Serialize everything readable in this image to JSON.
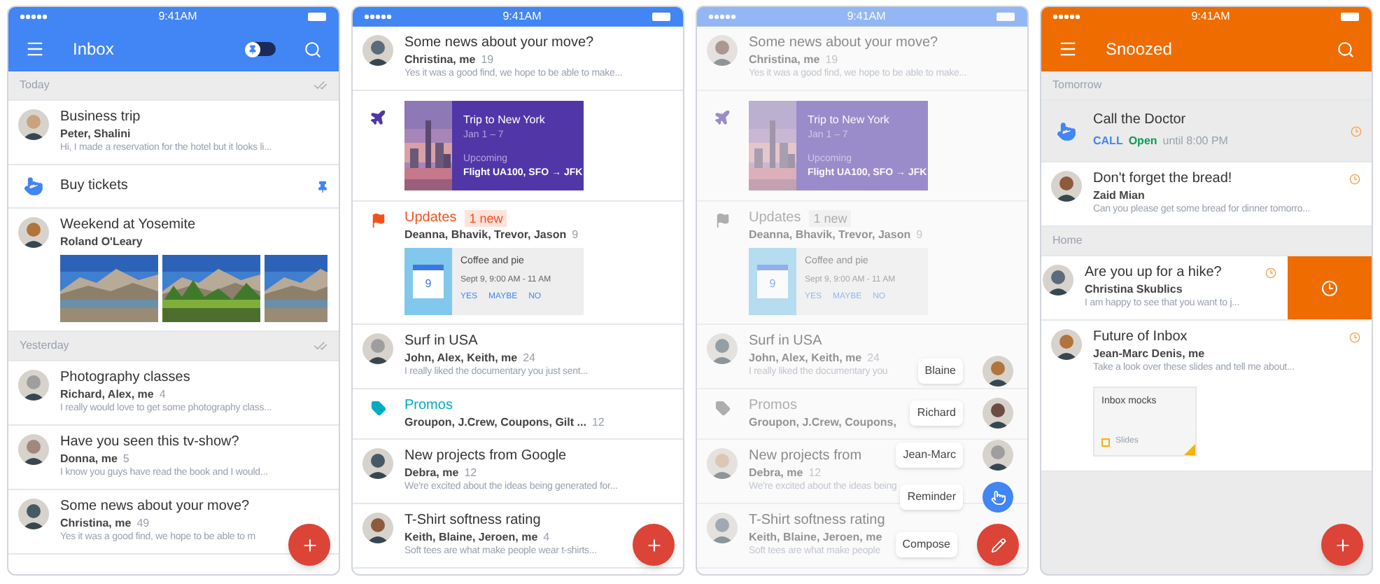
{
  "phones": [
    {
      "color": "#4285f4",
      "status_time": "9:41AM",
      "app_bar": {
        "title": "Inbox",
        "toggle": {
          "on": false
        }
      },
      "items": [
        {
          "kind": "header",
          "label": "Today",
          "done_all": true
        },
        {
          "kind": "message",
          "title": "Business trip",
          "senders": "Peter, Shalini",
          "snippet": "Hi, I made a reservation for the hotel but it looks li..."
        },
        {
          "kind": "reminder",
          "title": "Buy tickets",
          "pinned": true,
          "snoozed": false
        },
        {
          "kind": "message",
          "title": "Weekend at Yosemite",
          "senders": "Roland O'Leary"
        },
        {
          "kind": "header",
          "label": "Yesterday",
          "done_all": true
        },
        {
          "kind": "message",
          "title": "Photography classes",
          "senders": "Richard, Alex, me",
          "count": "4",
          "snippet": "I really would love to get some photography class..."
        },
        {
          "kind": "message",
          "title": "Have you seen this tv-show?",
          "senders": "Donna, me",
          "count": "5",
          "snippet": "I know you guys have read the book and I would..."
        },
        {
          "kind": "message",
          "title": "Some news about your move?",
          "senders": "Christina, me",
          "count": "49",
          "snippet": "Yes it was a good find, we hope to be able to m"
        }
      ]
    },
    {
      "color": "#4285f4",
      "status_time": "9:41AM",
      "items": [
        {
          "kind": "message",
          "title": "Some news about your move?",
          "senders": "Christina, me",
          "count": "19",
          "snippet": "Yes it was a good find, we hope to be able to make..."
        },
        {
          "kind": "trip",
          "title": "Trip to New York",
          "dates": "Jan 1 – 7",
          "status": "Upcoming",
          "detail": "Flight UA100, SFO → JFK"
        },
        {
          "kind": "updates",
          "color": "#f4511e",
          "label": "Updates",
          "badge": "1 new",
          "senders": "Deanna, Bhavik, Trevor, Jason",
          "count": "9",
          "event": {
            "day": "9",
            "title": "Coffee and pie",
            "time": "Sept 9, 9:00 AM - 11 AM",
            "actions": [
              "YES",
              "MAYBE",
              "NO"
            ]
          }
        },
        {
          "kind": "message",
          "title": "Surf in USA",
          "senders": "John, Alex, Keith, me",
          "count": "24",
          "snippet": "I really liked the documentary you just sent..."
        },
        {
          "kind": "promos",
          "color": "#00acc1",
          "label": "Promos",
          "senders": "Groupon, J.Crew, Coupons, Gilt ...",
          "count": "12"
        },
        {
          "kind": "message",
          "title": "New projects from Google",
          "senders": "Debra, me",
          "count": "12",
          "snippet": "We're excited about the ideas being generated for..."
        },
        {
          "kind": "message",
          "title": "T-Shirt softness rating",
          "senders": "Keith, Blaine, Jeroen, me",
          "count": "4",
          "snippet": "Soft tees are what make people wear t-shirts..."
        }
      ]
    },
    {
      "color": "#4285f4",
      "status_time": "9:41AM",
      "dimmed": true,
      "items": [
        {
          "kind": "message",
          "title": "Some news about your move?",
          "senders": "Christina, me",
          "count": "19",
          "snippet": "Yes it was a good find, we hope to be able to make..."
        },
        {
          "kind": "trip",
          "title": "Trip to New York",
          "dates": "Jan 1 – 7",
          "status": "Upcoming",
          "detail": "Flight UA100, SFO → JFK"
        },
        {
          "kind": "updates",
          "label": "Updates",
          "badge": "1 new",
          "senders": "Deanna, Bhavik, Trevor, Jason",
          "count": "9",
          "event": {
            "day": "9",
            "title": "Coffee and pie",
            "time": "Sept 9, 9:00 AM - 11 AM",
            "actions": [
              "YES",
              "MAYBE",
              "NO"
            ]
          }
        },
        {
          "kind": "message",
          "title": "Surf in USA",
          "senders": "John, Alex, Keith, me",
          "count": "24",
          "snippet": "I really liked the documentary you"
        },
        {
          "kind": "promos",
          "label": "Promos",
          "senders": "Groupon, J.Crew, Coupons,"
        },
        {
          "kind": "message",
          "title": "New projects from",
          "senders": "Debra, me",
          "count": "12",
          "snippet": "We're excited about the ideas being"
        },
        {
          "kind": "message",
          "title": "T-Shirt softness rating",
          "senders": "Keith, Blaine, Jeroen, me",
          "snippet": "Soft tees are what make people"
        }
      ],
      "speed_dial": [
        {
          "kind": "contact",
          "label": "Blaine"
        },
        {
          "kind": "contact",
          "label": "Richard"
        },
        {
          "kind": "contact",
          "label": "Jean-Marc"
        },
        {
          "kind": "reminder",
          "label": "Reminder"
        },
        {
          "kind": "compose",
          "label": "Compose"
        }
      ]
    },
    {
      "color": "#ef6c00",
      "status_time": "9:41AM",
      "app_bar": {
        "title": "Snoozed"
      },
      "items": [
        {
          "kind": "header",
          "label": "Tomorrow",
          "done_all": false
        },
        {
          "kind": "reminder",
          "title": "Call the Doctor",
          "action": "CALL",
          "status": "Open",
          "detail": "until 8:00 PM",
          "pinned": false,
          "snoozed": true
        },
        {
          "kind": "message",
          "title": "Don't forget the bread!",
          "senders": "Zaid Mian",
          "snippet": "Can you please get some bread for dinner tomorro...",
          "snoozed": true,
          "swiped": false
        },
        {
          "kind": "header",
          "label": "Home",
          "done_all": false
        },
        {
          "kind": "message",
          "title": "Are you up for a hike?",
          "senders": "Christina Skublics",
          "snippet": "I am happy to see that you want to j...",
          "snoozed": true,
          "swiped": true
        },
        {
          "kind": "message",
          "title": "Future of Inbox",
          "senders": "Jean-Marc Denis, me",
          "snippet": "Take a look over these slides and tell me about...",
          "snoozed": true,
          "swiped": false,
          "attachment": {
            "title": "Inbox mocks",
            "type": "Slides"
          }
        }
      ]
    }
  ]
}
